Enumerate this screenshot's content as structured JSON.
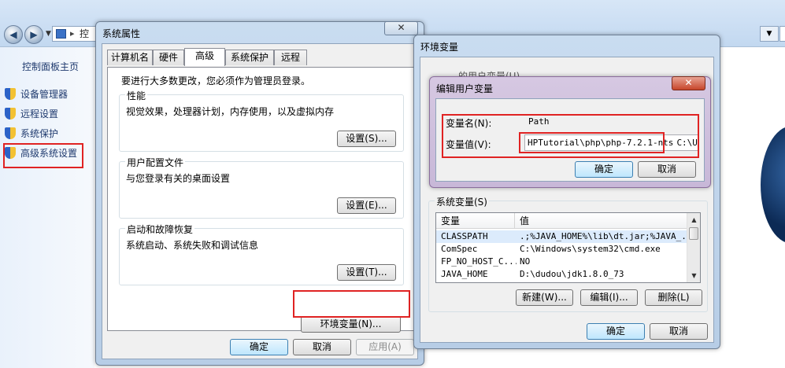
{
  "explorer": {
    "address_text": "控",
    "sidebar_home": "控制面板主页",
    "sidebar_items": [
      "设备管理器",
      "远程设置",
      "系统保护",
      "高级系统设置"
    ]
  },
  "sysprops": {
    "title": "系统属性",
    "close": "✕",
    "tabs": [
      "计算机名",
      "硬件",
      "高级",
      "系统保护",
      "远程"
    ],
    "admin_note": "要进行大多数更改，您必须作为管理员登录。",
    "performance": {
      "label": "性能",
      "desc": "视觉效果，处理器计划，内存使用，以及虚拟内存",
      "button": "设置(S)..."
    },
    "profile": {
      "label": "用户配置文件",
      "desc": "与您登录有关的桌面设置",
      "button": "设置(E)..."
    },
    "startup": {
      "label": "启动和故障恢复",
      "desc": "系统启动、系统失败和调试信息",
      "button": "设置(T)..."
    },
    "env_button": "环境变量(N)...",
    "ok": "确定",
    "cancel": "取消",
    "apply": "应用(A)"
  },
  "envvars": {
    "title": "环境变量",
    "user_group_partial": "的用户变量(U)",
    "system_group": "系统变量(S)",
    "columns": [
      "变量",
      "值"
    ],
    "rows": [
      [
        "CLASSPATH",
        ".;%JAVA_HOME%\\lib\\dt.jar;%JAVA_..."
      ],
      [
        "ComSpec",
        "C:\\Windows\\system32\\cmd.exe"
      ],
      [
        "FP_NO_HOST_C...",
        "NO"
      ],
      [
        "JAVA_HOME",
        "D:\\dudou\\jdk1.8.0_73"
      ]
    ],
    "new": "新建(W)...",
    "edit": "编辑(I)...",
    "delete": "删除(L)",
    "ok": "确定",
    "cancel": "取消"
  },
  "edituser": {
    "title": "编辑用户变量",
    "close": "✕",
    "name_label": "变量名(N):",
    "name_value": "Path",
    "value_label": "变量值(V):",
    "value_value": "HPTutorial\\php\\php-7.2.1-nts",
    "value_tail": "C:\\Use",
    "ok": "确定",
    "cancel": "取消"
  },
  "colors": {
    "highlight": "#e02323",
    "window_frame": "#b7cde6"
  }
}
